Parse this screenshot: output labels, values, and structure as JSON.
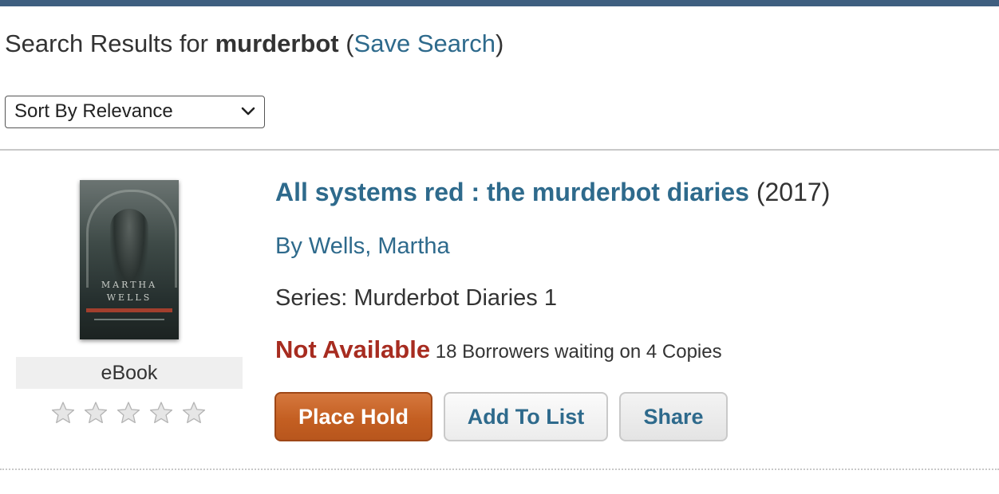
{
  "search": {
    "prefix": "Search Results for ",
    "term": "murderbot",
    "open_paren": " (",
    "save_link": "Save Search",
    "close_paren": ")"
  },
  "sort": {
    "selected": "Sort By Relevance"
  },
  "result": {
    "cover": {
      "author_line1": "MARTHA",
      "author_line2": "WELLS"
    },
    "format": "eBook",
    "rating": {
      "stars_filled": 0,
      "stars_total": 5
    },
    "title": "All systems red : the murderbot diaries",
    "year": " (2017)",
    "author": "By Wells, Martha",
    "series": "Series: Murderbot Diaries 1",
    "availability": {
      "status": "Not Available",
      "detail": " 18 Borrowers waiting on 4 Copies"
    },
    "buttons": {
      "place_hold": "Place Hold",
      "add_to_list": "Add To List",
      "share": "Share"
    }
  },
  "colors": {
    "top_bar": "#3f5f80",
    "link": "#2e6a8c",
    "not_available": "#a72c20",
    "place_hold": "#c45f22",
    "star": "#e6e6e6"
  },
  "icons": {
    "sort_chevron": "chevron-down-icon",
    "rating_star": "star-icon"
  }
}
